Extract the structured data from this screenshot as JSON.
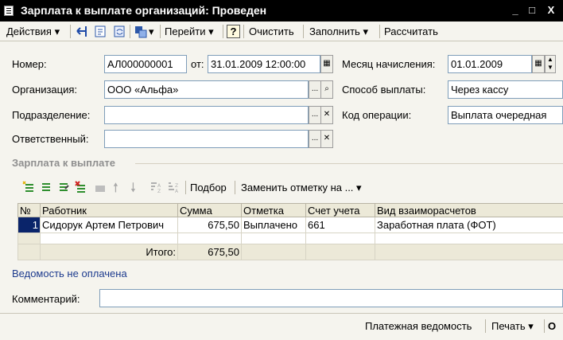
{
  "window": {
    "title": "Зарплата к выплате организаций: Проведен",
    "minimize": "_",
    "maximize": "□",
    "close": "X"
  },
  "toolbar": {
    "actions": "Действия",
    "goto": "Перейти",
    "help": "?",
    "clear": "Очистить",
    "fill": "Заполнить",
    "calculate": "Рассчитать"
  },
  "form": {
    "number_label": "Номер:",
    "number": "АЛ000000001",
    "date_label": "от:",
    "date": "31.01.2009 12:00:00",
    "org_label": "Организация:",
    "org": "ООО «Альфа»",
    "dept_label": "Подразделение:",
    "dept": "",
    "resp_label": "Ответственный:",
    "resp": "",
    "month_label": "Месяц начисления:",
    "month": "01.01.2009",
    "payment_label": "Способ выплаты:",
    "payment": "Через кассу",
    "opcode_label": "Код операции:",
    "opcode": "Выплата очередная",
    "ellipsis": "...",
    "clear_x": "✕",
    "search_icon_glyph": "🔍"
  },
  "section": {
    "title": "Зарплата к выплате"
  },
  "table_toolbar": {
    "select": "Подбор",
    "replace_mark": "Заменить отметку на ..."
  },
  "table": {
    "columns": [
      "№",
      "Работник",
      "Сумма",
      "Отметка",
      "Счет учета",
      "Вид взаиморасчетов"
    ],
    "rows": [
      {
        "n": "1",
        "employee": "Сидорук Артем Петрович",
        "sum": "675,50",
        "mark": "Выплачено",
        "account": "661",
        "type": "Заработная плата (ФОТ)"
      }
    ],
    "total_label": "Итого:",
    "total_sum": "675,50"
  },
  "status_link": "Ведомость не оплачена",
  "comment": {
    "label": "Комментарий:",
    "value": ""
  },
  "bottom": {
    "payment_sheet": "Платежная ведомость",
    "print": "Печать",
    "ok": "О"
  },
  "colors": {
    "titlebar": "#000000",
    "selection": "#0a246a",
    "link": "#1d3b8e"
  }
}
